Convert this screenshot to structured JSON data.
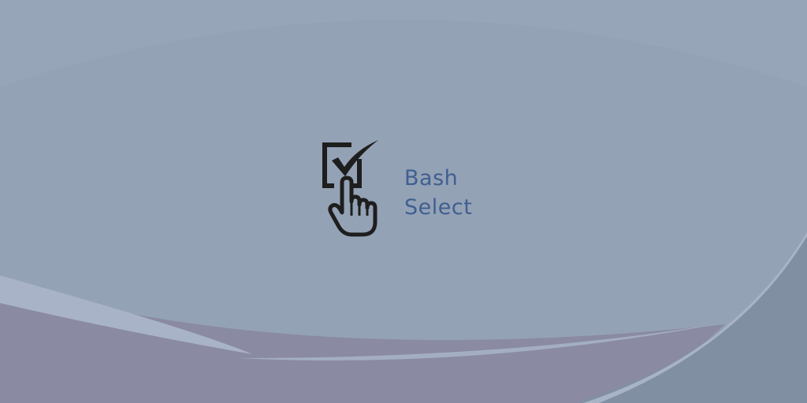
{
  "logo": {
    "line1": "Bash",
    "line2": "Select",
    "icon": "checkbox-pointer-icon"
  },
  "colors": {
    "background": "#94a2b6",
    "wave_top": "#8fa0b5",
    "wave_purple": "#8a8aa3",
    "wave_highlight": "#a8b4c6",
    "wave_right": "#808ea2",
    "text": "#3f5f8f",
    "icon": "#1e1e1e"
  }
}
